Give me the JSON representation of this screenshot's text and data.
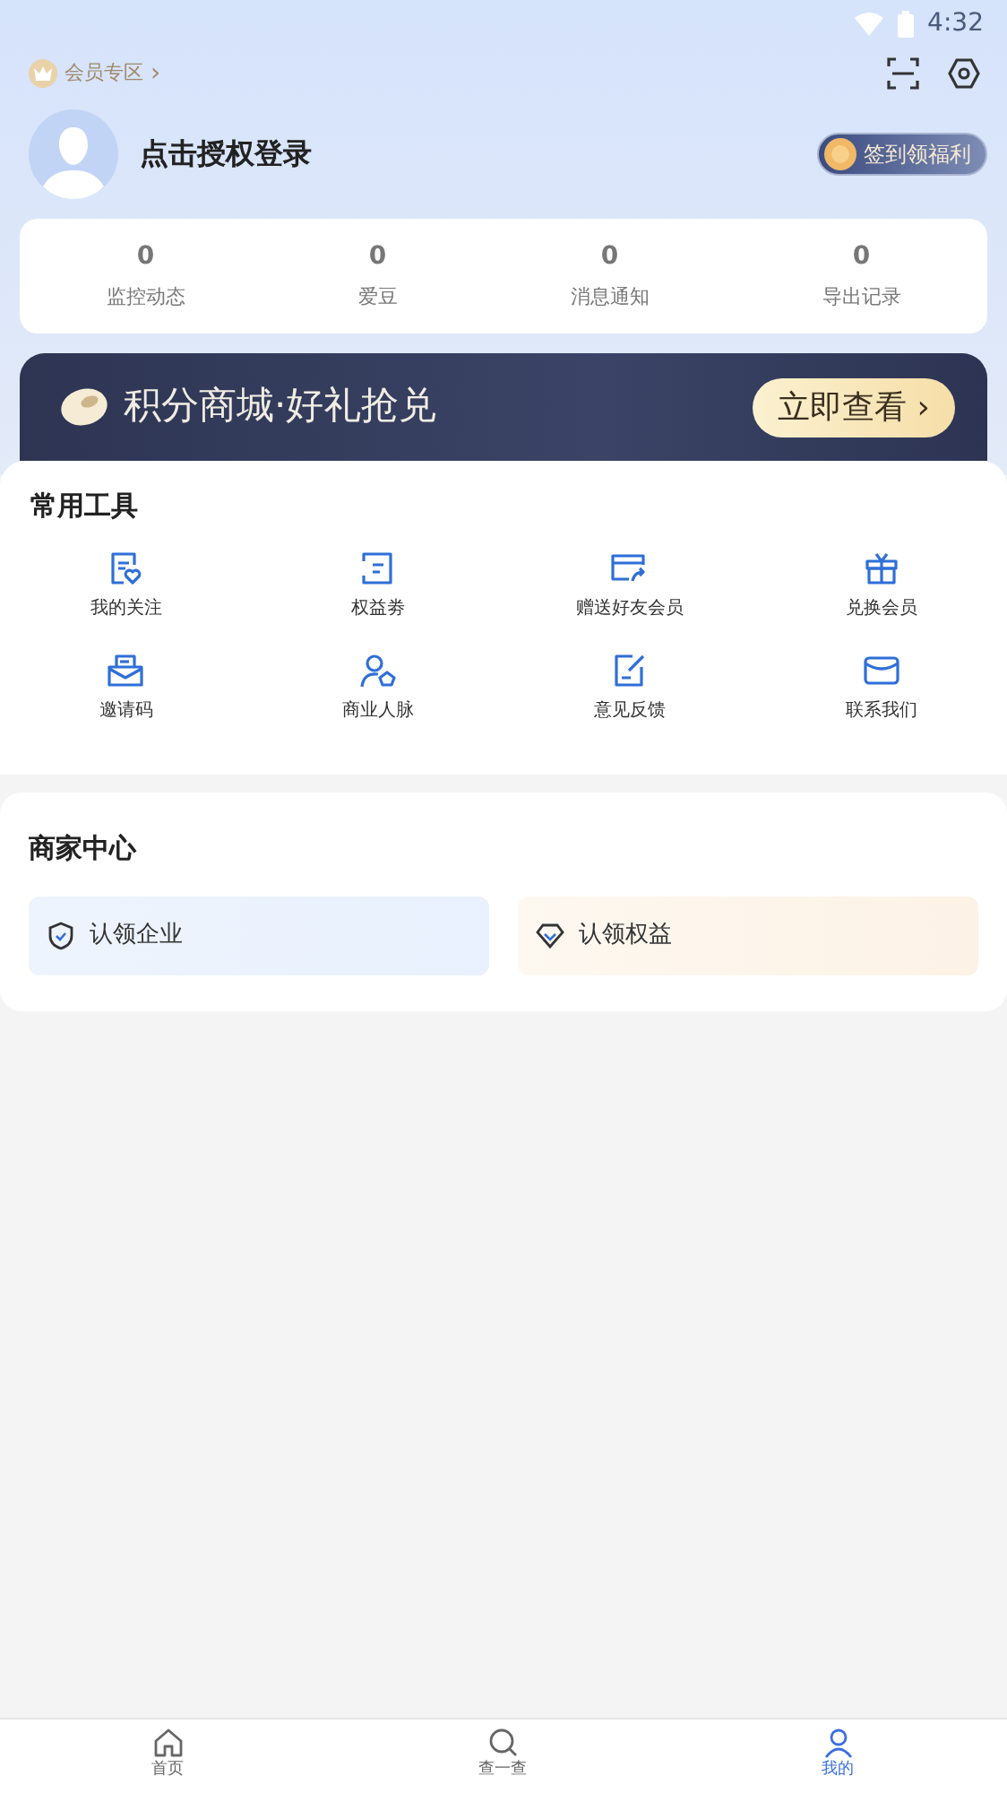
{
  "status_bar": {
    "time": "4:32"
  },
  "member_link": {
    "label": "会员专区",
    "chevron": "›"
  },
  "profile": {
    "login_text": "点击授权登录",
    "checkin_button": "签到领福利"
  },
  "stats": [
    {
      "value": "0",
      "label": "监控动态"
    },
    {
      "value": "0",
      "label": "爱豆"
    },
    {
      "value": "0",
      "label": "消息通知"
    },
    {
      "value": "0",
      "label": "导出记录"
    }
  ],
  "banner": {
    "title": "积分商城·好礼抢兑",
    "button": "立即查看",
    "chevron": "›"
  },
  "tools": {
    "title": "常用工具",
    "items": [
      {
        "label": "我的关注"
      },
      {
        "label": "权益劵"
      },
      {
        "label": "赠送好友会员"
      },
      {
        "label": "兑换会员"
      },
      {
        "label": "邀请码"
      },
      {
        "label": "商业人脉"
      },
      {
        "label": "意见反馈"
      },
      {
        "label": "联系我们"
      }
    ]
  },
  "merchant": {
    "title": "商家中心",
    "items": [
      {
        "label": "认领企业",
        "kind": "enterprise"
      },
      {
        "label": "认领权益",
        "kind": "benefit"
      }
    ]
  },
  "bottom_nav": [
    {
      "label": "首页",
      "selected": false
    },
    {
      "label": "查一查",
      "selected": false
    },
    {
      "label": "我的",
      "selected": true
    }
  ]
}
